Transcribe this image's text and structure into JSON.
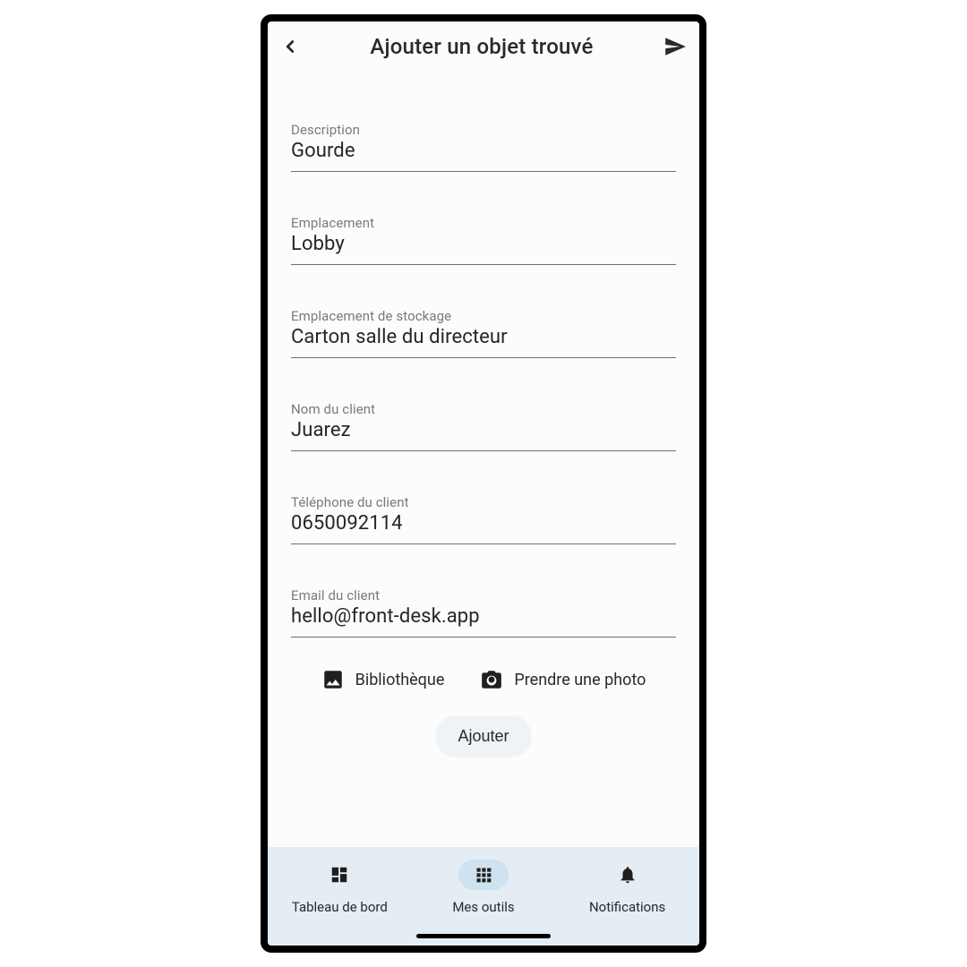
{
  "header": {
    "title": "Ajouter un objet trouvé"
  },
  "fields": {
    "description": {
      "label": "Description",
      "value": "Gourde"
    },
    "location": {
      "label": "Emplacement",
      "value": "Lobby"
    },
    "storage": {
      "label": "Emplacement de stockage",
      "value": "Carton salle du directeur"
    },
    "client_name": {
      "label": "Nom du client",
      "value": "Juarez"
    },
    "client_phone": {
      "label": "Téléphone du client",
      "value": "0650092114"
    },
    "client_email": {
      "label": "Email du client",
      "value": "hello@front-desk.app"
    }
  },
  "photo": {
    "library": "Bibliothèque",
    "take_photo": "Prendre une photo"
  },
  "buttons": {
    "add": "Ajouter"
  },
  "tabs": {
    "dashboard": "Tableau de bord",
    "tools": "Mes outils",
    "notifications": "Notifications"
  }
}
